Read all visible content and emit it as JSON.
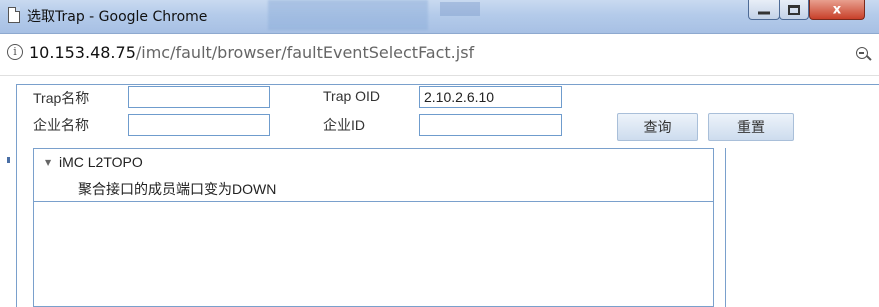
{
  "window": {
    "title": "选取Trap - Google Chrome",
    "buttons": {
      "minimize": "",
      "maximize": "",
      "close": "x"
    }
  },
  "address": {
    "host": "10.153.48.75",
    "path": "/imc/fault/browser/faultEventSelectFact.jsf",
    "info_icon": "i"
  },
  "form": {
    "trap_name_label": "Trap名称",
    "trap_name_value": "",
    "trap_oid_label": "Trap OID",
    "trap_oid_value": "2.10.2.6.10",
    "enterprise_name_label": "企业名称",
    "enterprise_name_value": "",
    "enterprise_id_label": "企业ID",
    "enterprise_id_value": "",
    "query_button": "查询",
    "reset_button": "重置"
  },
  "tree": {
    "caret": "▼",
    "node_label": "iMC L2TOPO",
    "children": [
      "聚合接口的成员端口变为DOWN"
    ]
  }
}
